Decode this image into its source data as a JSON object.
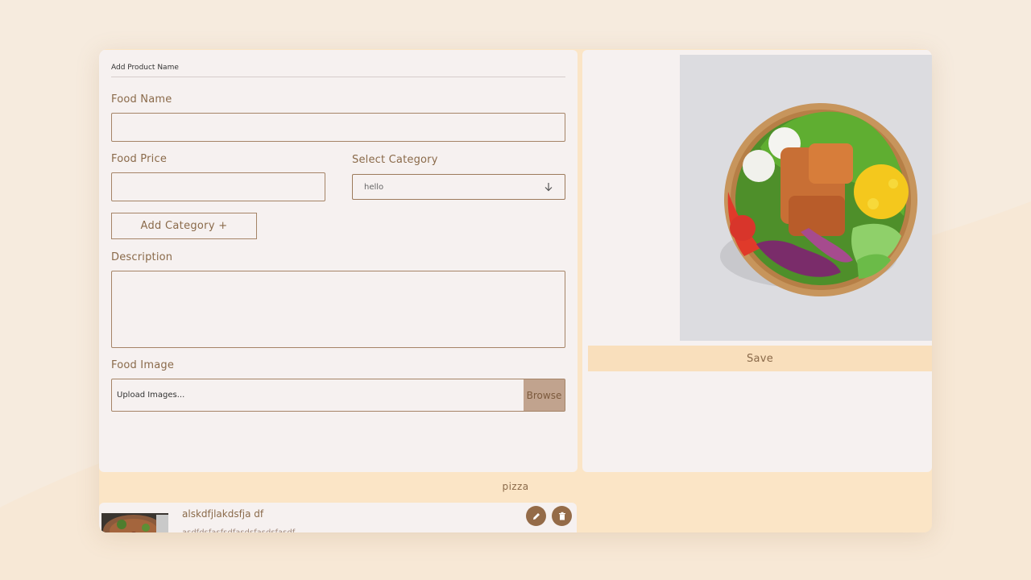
{
  "form": {
    "heading": "Add Product Name",
    "food_name_label": "Food Name",
    "food_name_value": "",
    "food_price_label": "Food Price",
    "food_price_value": "",
    "category_label": "Select Category",
    "category_value": "hello",
    "add_category_label": "Add Category +",
    "description_label": "Description",
    "description_value": "",
    "image_label": "Food Image",
    "upload_placeholder": "Upload Images...",
    "browse_label": "Browse"
  },
  "preview": {
    "save_label": "Save"
  },
  "category_section": {
    "title": "pizza"
  },
  "products": [
    {
      "name": "alskdfjlakdsfja df",
      "description": "asdfdsfasfsdfasdsfasdsfasdf"
    }
  ],
  "colors": {
    "accent": "#946b48",
    "panel": "#f6f1f0",
    "frame": "#fbe5c6",
    "save": "#f9dfbc",
    "browse": "#c1a38e"
  },
  "icons": [
    "arrow-down-icon",
    "edit-icon",
    "delete-icon"
  ]
}
